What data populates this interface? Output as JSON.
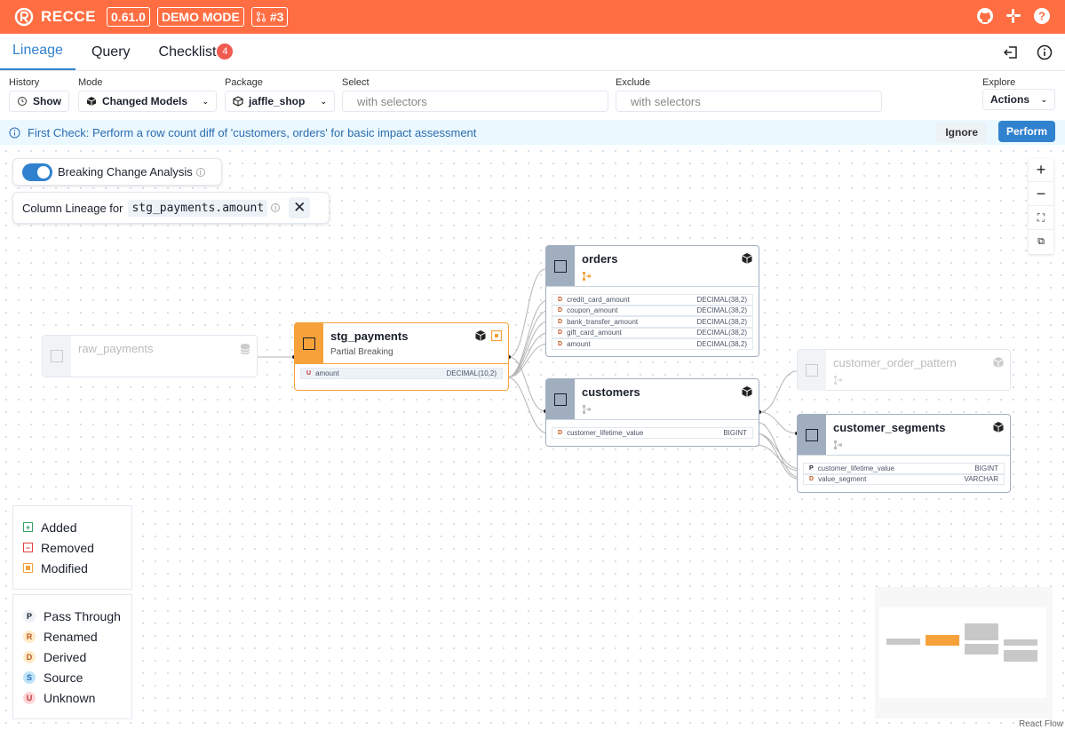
{
  "header": {
    "brand": "RECCE",
    "version": "0.61.0",
    "mode": "DEMO MODE",
    "pr": "#3",
    "icons": [
      "github-icon",
      "slack-icon",
      "help-icon"
    ]
  },
  "tabs": [
    {
      "label": "Lineage",
      "active": true
    },
    {
      "label": "Query"
    },
    {
      "label": "Checklist",
      "count": "4"
    }
  ],
  "filters": {
    "history": {
      "label": "History",
      "value": "Show"
    },
    "mode": {
      "label": "Mode",
      "value": "Changed Models"
    },
    "package": {
      "label": "Package",
      "value": "jaffle_shop"
    },
    "select": {
      "label": "Select",
      "placeholder": "with selectors"
    },
    "exclude": {
      "label": "Exclude",
      "placeholder": "with selectors"
    },
    "explore": {
      "label": "Explore",
      "value": "Actions"
    }
  },
  "info": {
    "message": "First Check: Perform a row count diff of 'customers, orders' for basic impact assessment",
    "ignore": "Ignore",
    "perform": "Perform"
  },
  "breaking": {
    "label": "Breaking Change Analysis",
    "enabled": true
  },
  "column_lineage": {
    "label": "Column Lineage for",
    "column": "stg_payments.amount"
  },
  "nodes": {
    "raw_payments": {
      "name": "raw_payments"
    },
    "stg_payments": {
      "name": "stg_payments",
      "sub": "Partial Breaking",
      "cols": [
        {
          "tag": "U",
          "name": "amount",
          "type": "DECIMAL(10,2)"
        }
      ]
    },
    "orders": {
      "name": "orders",
      "cols": [
        {
          "tag": "D",
          "name": "credit_card_amount",
          "type": "DECIMAL(38,2)"
        },
        {
          "tag": "D",
          "name": "coupon_amount",
          "type": "DECIMAL(38,2)"
        },
        {
          "tag": "D",
          "name": "bank_transfer_amount",
          "type": "DECIMAL(38,2)"
        },
        {
          "tag": "D",
          "name": "gift_card_amount",
          "type": "DECIMAL(38,2)"
        },
        {
          "tag": "D",
          "name": "amount",
          "type": "DECIMAL(38,2)"
        }
      ]
    },
    "customers": {
      "name": "customers",
      "cols": [
        {
          "tag": "D",
          "name": "customer_lifetime_value",
          "type": "BIGINT"
        }
      ]
    },
    "customer_order_pattern": {
      "name": "customer_order_pattern"
    },
    "customer_segments": {
      "name": "customer_segments",
      "cols": [
        {
          "tag": "P",
          "name": "customer_lifetime_value",
          "type": "BIGINT"
        },
        {
          "tag": "D",
          "name": "value_segment",
          "type": "VARCHAR"
        }
      ]
    }
  },
  "legend_change": [
    "Added",
    "Removed",
    "Modified"
  ],
  "legend_column": [
    {
      "tag": "P",
      "label": "Pass Through"
    },
    {
      "tag": "R",
      "label": "Renamed"
    },
    {
      "tag": "D",
      "label": "Derived"
    },
    {
      "tag": "S",
      "label": "Source"
    },
    {
      "tag": "U",
      "label": "Unknown"
    }
  ],
  "attribution": "React Flow"
}
